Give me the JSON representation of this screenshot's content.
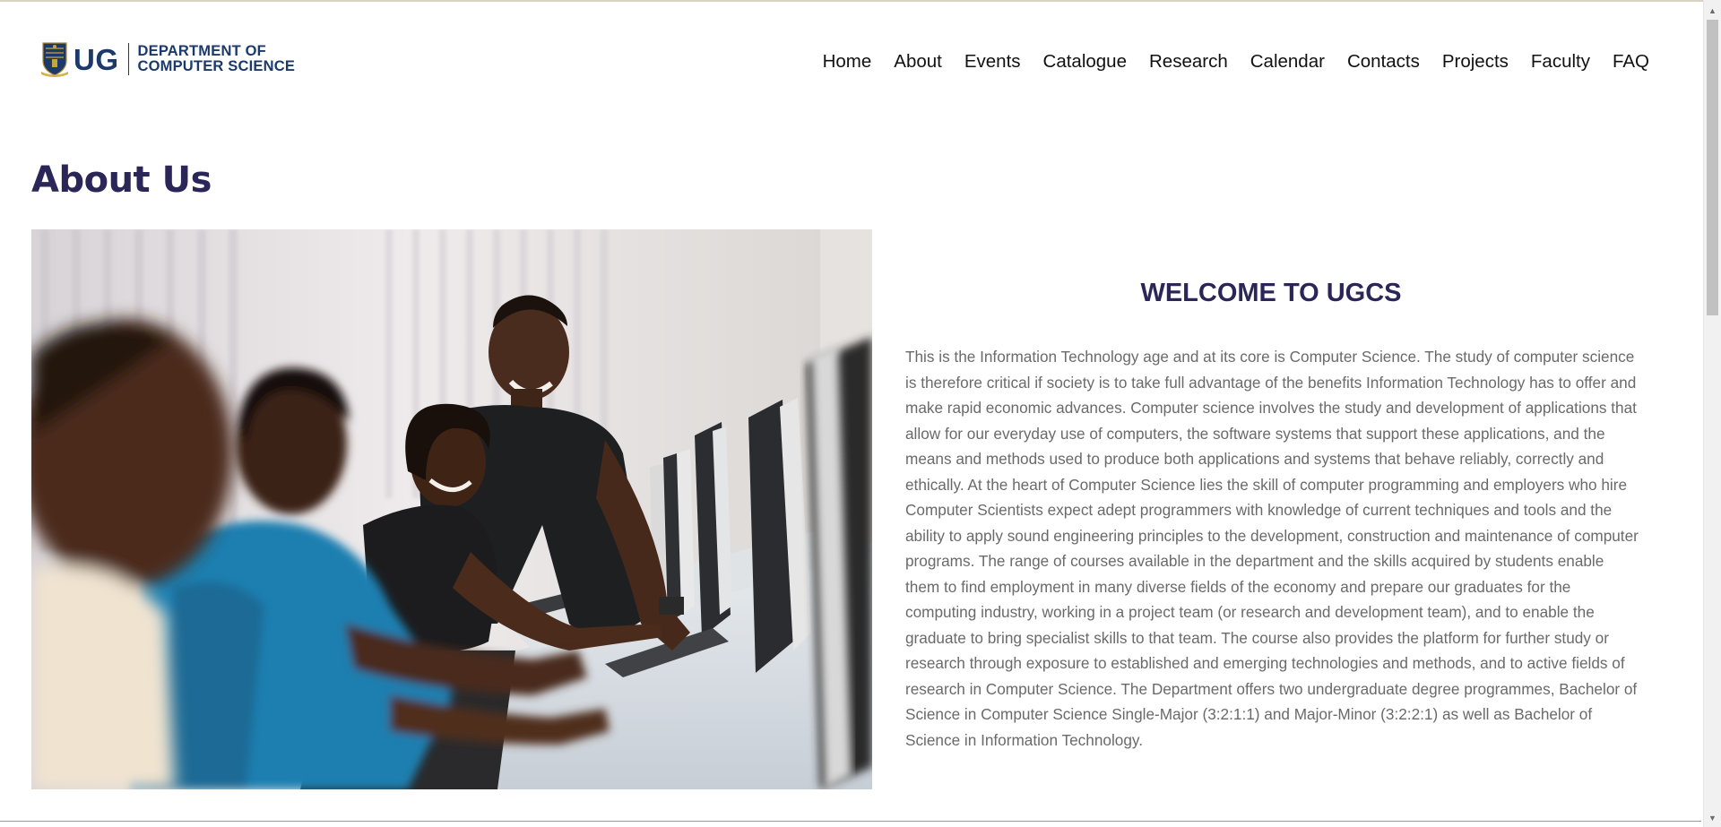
{
  "header": {
    "logo": {
      "ug": "UG",
      "line1": "DEPARTMENT OF",
      "line2": "COMPUTER SCIENCE"
    },
    "nav": [
      "Home",
      "About",
      "Events",
      "Catalogue",
      "Research",
      "Calendar",
      "Contacts",
      "Projects",
      "Faculty",
      "FAQ"
    ]
  },
  "page": {
    "title": "About Us"
  },
  "welcome": {
    "heading": "WELCOME TO UGCS",
    "body": "This is the Information Technology age and at its core is Computer Science. The study of computer science is therefore critical if society is to take full advantage of the benefits Information Technology has to offer and make rapid economic advances. Computer science involves the study and development of applications that allow for our everyday use of computers, the software systems that support these applications, and the means and methods used to produce both applications and systems that behave reliably, correctly and ethically. At the heart of Computer Science lies the skill of computer programming and employers who hire Computer Scientists expect adept programmers with knowledge of current techniques and tools and the ability to apply sound engineering principles to the development, construction and maintenance of computer programs. The range of courses available in the department and the skills acquired by students enable them to find employment in many diverse fields of the economy and prepare our graduates for the computing industry, working in a project team (or research and development team), and to enable the graduate to bring specialist skills to that team. The course also provides the platform for further study or research through exposure to established and emerging technologies and methods, and to active fields of research in Computer Science. The Department offers two undergraduate degree programmes, Bachelor of Science in Computer Science Single-Major (3:2:1:1) and Major-Minor (3:2:2:1) as well as Bachelor of Science in Information Technology."
  },
  "colors": {
    "brand_navy": "#1b3a6b",
    "title_purple": "#2a2658",
    "body_gray": "#6a6a6a"
  },
  "icons": {
    "crest": "university-crest-icon",
    "scroll_up": "scroll-up-arrow-icon",
    "scroll_down": "scroll-down-arrow-icon"
  }
}
